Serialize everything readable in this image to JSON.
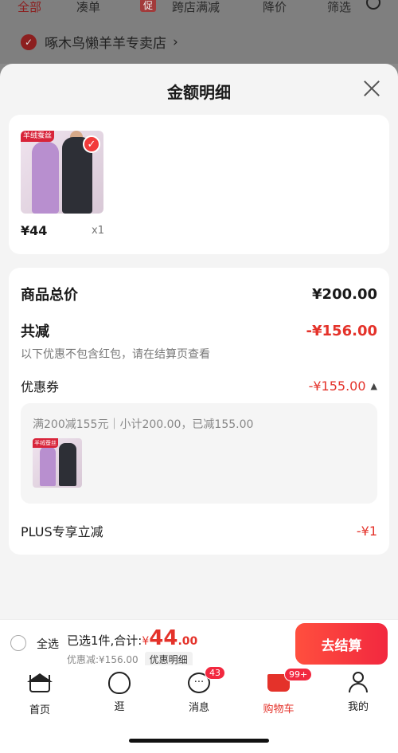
{
  "background": {
    "filters": [
      "全部",
      "凑单",
      "促",
      "跨店满减",
      "降价",
      "筛选"
    ],
    "shop_name": "啄木鸟懒羊羊专卖店",
    "shop_chevron": "›"
  },
  "sheet": {
    "title": "金额明细",
    "product": {
      "image_badge": "羊绒蚕丝",
      "price": "¥44",
      "qty": "x1"
    },
    "summary": {
      "total_label": "商品总价",
      "total_value": "¥200.00",
      "reduce_label": "共减",
      "reduce_value": "-¥156.00",
      "note": "以下优惠不包含红包，请在结算页查看",
      "coupon_label": "优惠券",
      "coupon_value": "-¥155.00",
      "coupon_detail": "满200减155元｜小计200.00，已减155.00",
      "plus_label": "PLUS专享立减",
      "plus_value": "-¥1"
    }
  },
  "checkout": {
    "select_all": "全选",
    "selected_text": "已选1件,合计:",
    "currency": "¥",
    "total_int": "44",
    "total_dec": ".00",
    "discount_text": "优惠减:¥156.00",
    "detail_chip": "优惠明细",
    "button": "去结算"
  },
  "tabbar": {
    "items": [
      {
        "label": "首页"
      },
      {
        "label": "逛"
      },
      {
        "label": "消息",
        "badge": "43"
      },
      {
        "label": "购物车",
        "badge": "99+"
      },
      {
        "label": "我的"
      }
    ]
  },
  "colors": {
    "accent": "#e4322a",
    "checkout_button": "#f2283f"
  }
}
